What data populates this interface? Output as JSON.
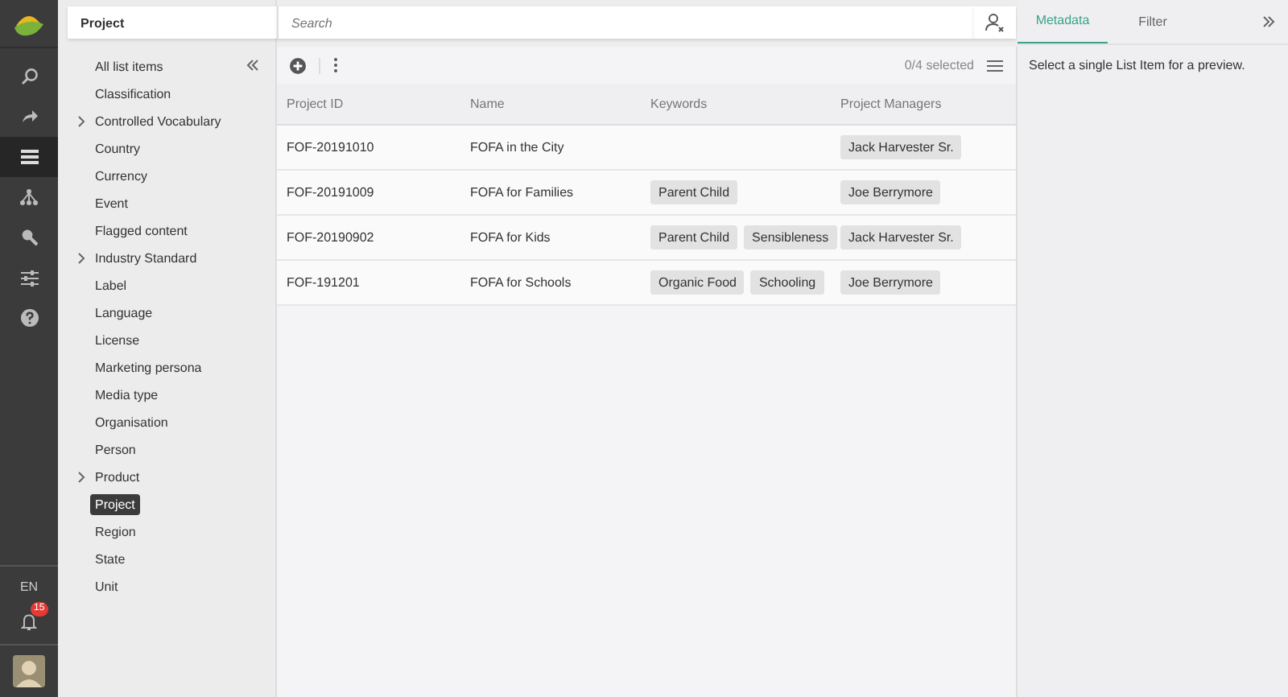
{
  "rail": {
    "items": [
      {
        "kind": "search",
        "selected": false
      },
      {
        "kind": "share",
        "selected": false
      },
      {
        "kind": "list",
        "selected": true
      },
      {
        "kind": "hierarchy",
        "selected": false
      },
      {
        "kind": "wrench",
        "selected": false
      },
      {
        "kind": "sliders",
        "selected": false
      },
      {
        "kind": "help",
        "selected": false
      }
    ],
    "language": "EN",
    "notifications": "15"
  },
  "header": {
    "title": "Project",
    "search": {
      "placeholder": "Search"
    }
  },
  "sidebar": {
    "items": [
      {
        "label": "All list items",
        "has_children": false,
        "selected": false
      },
      {
        "label": "Classification",
        "has_children": false,
        "selected": false
      },
      {
        "label": "Controlled Vocabulary",
        "has_children": true,
        "selected": false
      },
      {
        "label": "Country",
        "has_children": false,
        "selected": false
      },
      {
        "label": "Currency",
        "has_children": false,
        "selected": false
      },
      {
        "label": "Event",
        "has_children": false,
        "selected": false
      },
      {
        "label": "Flagged content",
        "has_children": false,
        "selected": false
      },
      {
        "label": "Industry Standard",
        "has_children": true,
        "selected": false
      },
      {
        "label": "Label",
        "has_children": false,
        "selected": false
      },
      {
        "label": "Language",
        "has_children": false,
        "selected": false
      },
      {
        "label": "License",
        "has_children": false,
        "selected": false
      },
      {
        "label": "Marketing persona",
        "has_children": false,
        "selected": false
      },
      {
        "label": "Media type",
        "has_children": false,
        "selected": false
      },
      {
        "label": "Organisation",
        "has_children": false,
        "selected": false
      },
      {
        "label": "Person",
        "has_children": false,
        "selected": false
      },
      {
        "label": "Product",
        "has_children": true,
        "selected": false
      },
      {
        "label": "Project",
        "has_children": false,
        "selected": true
      },
      {
        "label": "Region",
        "has_children": false,
        "selected": false
      },
      {
        "label": "State",
        "has_children": false,
        "selected": false
      },
      {
        "label": "Unit",
        "has_children": false,
        "selected": false
      }
    ]
  },
  "toolbar": {
    "selection": "0/4 selected"
  },
  "table": {
    "columns": [
      "Project ID",
      "Name",
      "Keywords",
      "Project Managers"
    ],
    "rows": [
      {
        "id": "FOF-20191010",
        "name": "FOFA in the City",
        "keywords": [],
        "managers": [
          "Jack Harvester Sr."
        ]
      },
      {
        "id": "FOF-20191009",
        "name": "FOFA for Families",
        "keywords": [
          "Parent Child"
        ],
        "managers": [
          "Joe Berrymore"
        ]
      },
      {
        "id": "FOF-20190902",
        "name": "FOFA for Kids",
        "keywords": [
          "Parent Child",
          "Sensibleness"
        ],
        "managers": [
          "Jack Harvester Sr."
        ]
      },
      {
        "id": "FOF-191201",
        "name": "FOFA for Schools",
        "keywords": [
          "Organic Food",
          "Schooling"
        ],
        "managers": [
          "Joe Berrymore"
        ]
      }
    ]
  },
  "preview": {
    "tabs": [
      {
        "label": "Metadata",
        "selected": true
      },
      {
        "label": "Filter",
        "selected": false
      }
    ],
    "message": "Select a single List Item for a preview."
  }
}
